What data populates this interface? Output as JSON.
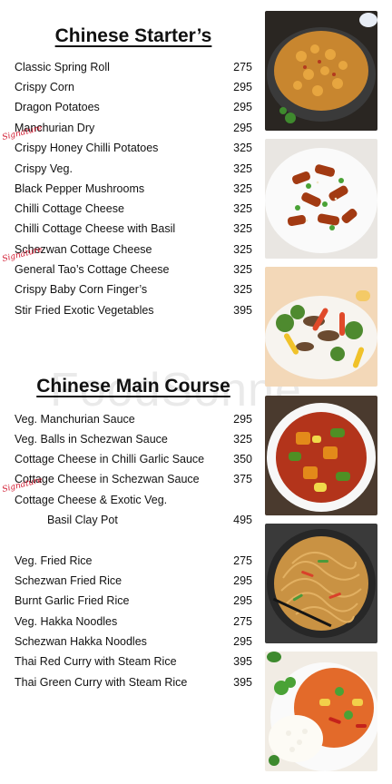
{
  "watermark": "FoodSonne",
  "signature_label": "Signature",
  "starters": {
    "title": "Chinese Starter’s",
    "items": [
      {
        "name": "Classic Spring Roll",
        "price": "275"
      },
      {
        "name": "Crispy Corn",
        "price": "295"
      },
      {
        "name": "Dragon Potatoes",
        "price": "295"
      },
      {
        "name": "Manchurian Dry",
        "price": "295"
      },
      {
        "name": "Crispy Honey Chilli Potatoes",
        "price": "325"
      },
      {
        "name": "Crispy Veg.",
        "price": "325"
      },
      {
        "name": "Black Pepper Mushrooms",
        "price": "325"
      },
      {
        "name": "Chilli Cottage Cheese",
        "price": "325"
      },
      {
        "name": "Chilli Cottage Cheese with Basil",
        "price": "325"
      },
      {
        "name": "Schezwan Cottage Cheese",
        "price": "325"
      },
      {
        "name": "General Tao’s Cottage Cheese",
        "price": "325"
      },
      {
        "name": "Crispy Baby Corn Finger’s",
        "price": "325"
      },
      {
        "name": "Stir Fried Exotic Vegetables",
        "price": "395"
      }
    ]
  },
  "main_course": {
    "title": "Chinese Main Course",
    "items": [
      {
        "name": "Veg. Manchurian Sauce",
        "price": "295"
      },
      {
        "name": "Veg. Balls in Schezwan Sauce",
        "price": "325"
      },
      {
        "name": "Cottage Cheese in Chilli Garlic Sauce",
        "price": "350"
      },
      {
        "name": "Cottage Cheese in Schezwan Sauce",
        "price": "375"
      },
      {
        "name": "Cottage Cheese & Exotic Veg.",
        "price": ""
      },
      {
        "name": "Basil Clay Pot",
        "price": "495"
      },
      {
        "name": "Veg. Fried Rice",
        "price": "275"
      },
      {
        "name": "Schezwan Fried Rice",
        "price": "295"
      },
      {
        "name": "Burnt Garlic Fried Rice",
        "price": "295"
      },
      {
        "name": "Veg. Hakka Noodles",
        "price": "275"
      },
      {
        "name": "Schezwan Hakka Noodles",
        "price": "295"
      },
      {
        "name": "Thai Red Curry with Steam Rice",
        "price": "395"
      },
      {
        "name": "Thai Green Curry with Steam Rice",
        "price": "395"
      }
    ]
  },
  "colors": {
    "signature": "#d0142b",
    "text": "#111111"
  },
  "photos": [
    "crispy-corn-photo",
    "chilli-potatoes-photo",
    "stir-fry-photo",
    "curry-photo",
    "noodles-photo",
    "thai-curry-rice-photo"
  ]
}
